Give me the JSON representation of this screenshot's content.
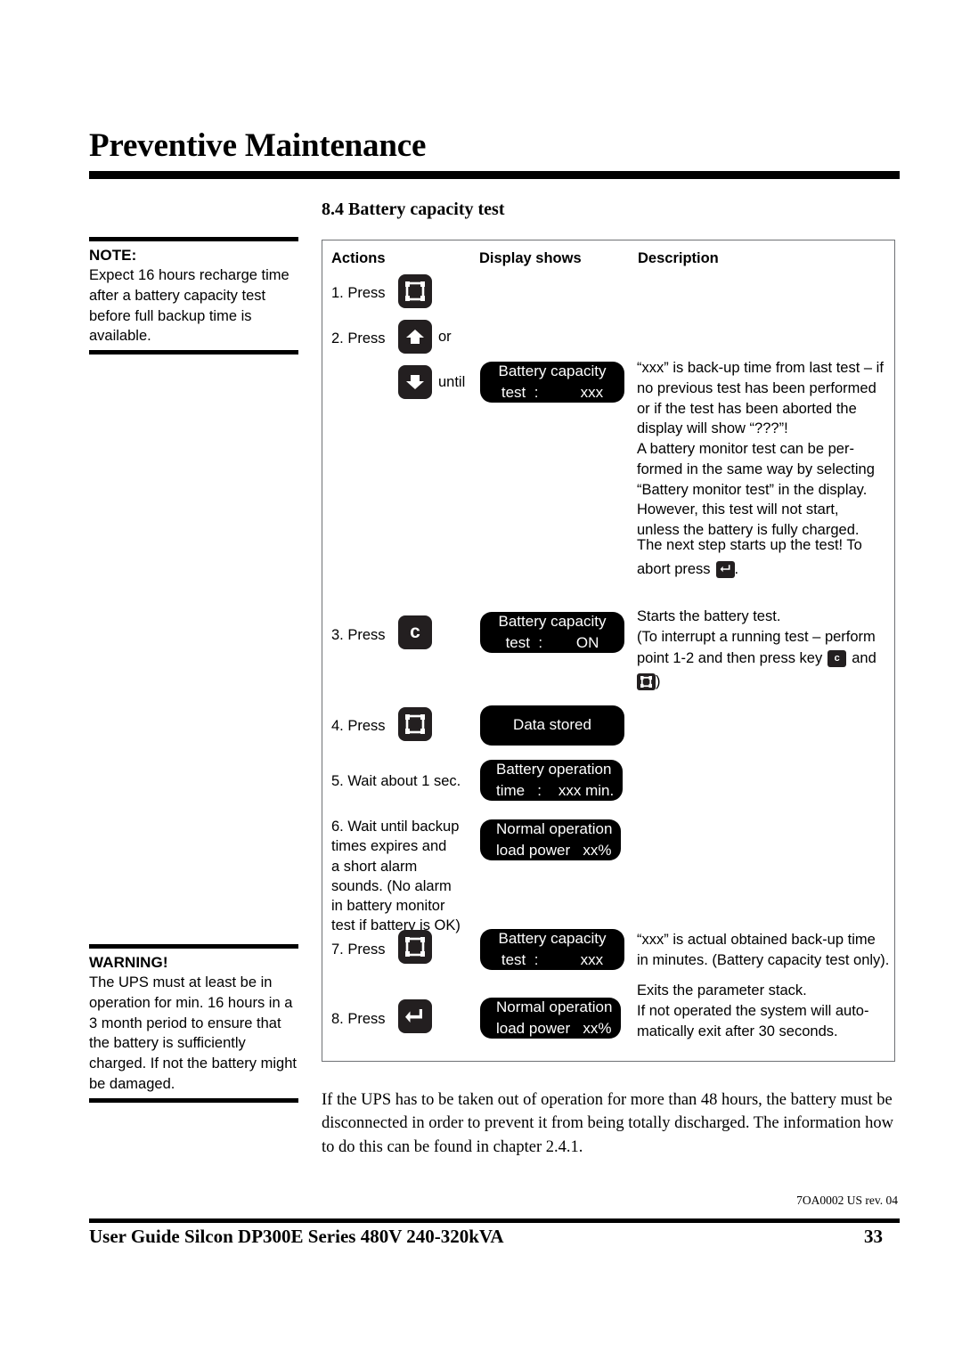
{
  "header": {
    "title": "Preventive Maintenance",
    "section_title": "8.4 Battery capacity test"
  },
  "note_box": {
    "title": "NOTE:",
    "body": "Expect 16 hours recharge time after a battery capacity test before full backup time is available."
  },
  "warning_box": {
    "title": "WARNING!",
    "body": "The UPS must at least be in operation for min. 16 hours in a 3 month period to ensure that the battery is sufficiently charged. If not the battery might be damaged."
  },
  "table": {
    "headers": {
      "actions": "Actions",
      "display": "Display shows",
      "description": "Description"
    },
    "steps": [
      {
        "label": "1. Press",
        "key_icon": "frame-key-icon"
      },
      {
        "label": "2. Press",
        "key_icon": "arrow-up-key-icon",
        "conjunction": "or",
        "key_icon2": "arrow-down-key-icon",
        "until": "until",
        "display_line1": "Battery capacity",
        "display_line2": "test  :          xxx",
        "description": "“xxx” is back-up time from last test – if no previous test has been performed or if the test has been aborted the display will show “???”! A battery monitor test can be per-formed in the same way by selecting “Battery monitor test” in the display. However, this test will not start, unless the battery is fully charged.",
        "description_lines": [
          "“xxx” is back-up time from last test – if",
          "no previous test has been performed",
          "or if the test has been aborted the",
          "display will show “???”!",
          "A battery monitor test can be per-",
          "formed in the same way by selecting",
          "“Battery monitor test” in the display.",
          "However, this test will not start,",
          "unless the battery is fully charged."
        ]
      },
      {
        "label": "3. Press",
        "key_icon": "letter-c-key-icon",
        "key_letter": "c",
        "display_line1": "Battery capacity",
        "display_line2": "test  :        ON",
        "description_lines": [
          "Starts the battery test.",
          "(To interrupt a running test – perform",
          "point 1-2 and then press key"
        ],
        "desc_inline_after": "and",
        "desc_close_paren": ")"
      },
      {
        "label": "4. Press",
        "key_icon": "frame-key-icon",
        "display_line1": "Data stored"
      },
      {
        "label": "5. Wait about 1 sec.",
        "display_line1": "Battery operation",
        "display_line2": "time   :    xxx min."
      },
      {
        "label": "6. Wait until backup\n    times expires and\n    a short  alarm\n    sounds. (No alarm\n    in battery monitor\n    test if battery is OK)",
        "display_line1": "Normal operation",
        "display_line2": "load power   xx%"
      },
      {
        "label": "7. Press",
        "key_icon": "frame-key-icon",
        "display_line1": "Battery capacity",
        "display_line2": "test  :          xxx",
        "description_lines": [
          "“xxx” is actual obtained back-up time",
          "in minutes. (Battery capacity test only)."
        ]
      },
      {
        "label": "8. Press",
        "key_icon": "enter-key-icon",
        "display_line1": "Normal operation",
        "display_line2": "load power   xx%",
        "description_lines": [
          "Exits the parameter stack.",
          "If not operated the system will auto-",
          "matically exit after 30 seconds."
        ]
      }
    ],
    "abort_note": {
      "line1": "The next step starts up the test! To",
      "line2_before": "abort press",
      "line2_after": ".",
      "key_icon": "enter-key-icon"
    }
  },
  "bottom_paragraph": "If the UPS has to be taken out of operation for more than 48 hours, the battery must be disconnected in order to prevent it from being totally discharged. The information how to do this can be found in chapter 2.4.1.",
  "footer": {
    "code": "7OA0002 US rev. 04",
    "title": "User Guide Silcon DP300E Series 480V 240-320kVA",
    "page_number": "33"
  },
  "colors": {
    "key_background": "#231f20",
    "lcd_background": "#000000",
    "lcd_text": "#ffffff",
    "table_border": "#6e7174",
    "rule": "#000000"
  }
}
